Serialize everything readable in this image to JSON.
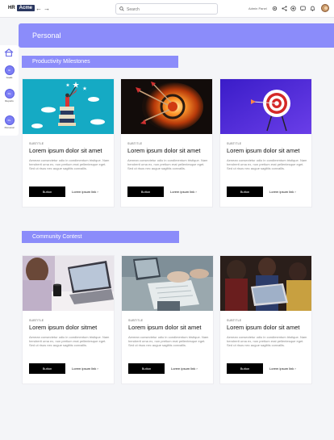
{
  "page_tag": "gazeitt",
  "header": {
    "logo_hr": "HR",
    "logo_acme": "Acme",
    "back_arrow": "←",
    "forward_arrow": "→",
    "search_placeholder": "Search",
    "user_name": "Admin Panel"
  },
  "sidebar": {
    "items": [
      {
        "icon": "Gl",
        "label": "Goals"
      },
      {
        "icon": "Rp",
        "label": "Reports"
      },
      {
        "icon": "Pe",
        "label": "Personal"
      }
    ]
  },
  "banner": {
    "title": "Personal"
  },
  "sections": [
    {
      "title": "Productivity Milestones",
      "cards": [
        {
          "subtitle": "SUBTITLE",
          "title": "Lorem ipsum dolor sit amet",
          "description": "Aenean consectetur odio in condimentum tristique. Nam hendrerit urna ex, non pretium erat pellentesque eget. Sed ut risus nec augue sagittis convallis.",
          "button": "Button",
          "link": "Lorem ipsum link  ›",
          "image": "achievement-books-illustration"
        },
        {
          "subtitle": "SUBTITLE",
          "title": "Lorem ipsum dolor sit amet",
          "description": "Aenean consectetur odio in condimentum tristique. Nam hendrerit urna ex, non pretium erat pellentesque eget. Sed ut risus nec augue sagittis convallis.",
          "button": "Button",
          "link": "Lorem ipsum link  ›",
          "image": "darts-explosion-photo"
        },
        {
          "subtitle": "SUBTITLE",
          "title": "Lorem ipsum dolor sit amet",
          "description": "Aenean consectetur odio in condimentum tristique. Nam hendrerit urna ex, non pretium erat pellentesque eget. Sed ut risus nec augue sagittis convallis.",
          "button": "Button",
          "link": "Lorem ipsum link  ›",
          "image": "target-arrow-purple"
        }
      ]
    },
    {
      "title": "Community Contest",
      "cards": [
        {
          "subtitle": "SUBTITLE",
          "title": "Lorem ipsum dolor sitmet",
          "description": "Aenean consectetur odio in condimentum tristique. Nam hendrerit urna ex, non pretium erat pellentesque eget. Sed ut risus nec augue sagittis convallis.",
          "button": "Button",
          "link": "Lorem ipsum link  ›",
          "image": "laptop-coffee-photo"
        },
        {
          "subtitle": "SUBTITLE",
          "title": "Lorem ipsum dolor sit amet",
          "description": "Aenean consectetur odio in condimentum tristique. Nam hendrerit urna ex, non pretium erat pellentesque eget. Sed ut risus nec augue sagittis convallis.",
          "button": "Button",
          "link": "Lorem ipsum link  ›",
          "image": "meeting-documents-photo"
        },
        {
          "subtitle": "SUBTITLE",
          "title": "Lorem ipsum dolor sit amet",
          "description": "Aenean consectetur odio in condimentum tristique. Nam hendrerit urna ex, non pretium erat pellentesque eget. Sed ut risus nec augue sagittis convallis.",
          "button": "Button",
          "link": "Lorem ipsum link  ›",
          "image": "team-laptop-photo"
        }
      ]
    }
  ],
  "colors": {
    "accent": "#8b8cfa",
    "sidebar_circle": "#7c7ef5",
    "button": "#000000"
  }
}
